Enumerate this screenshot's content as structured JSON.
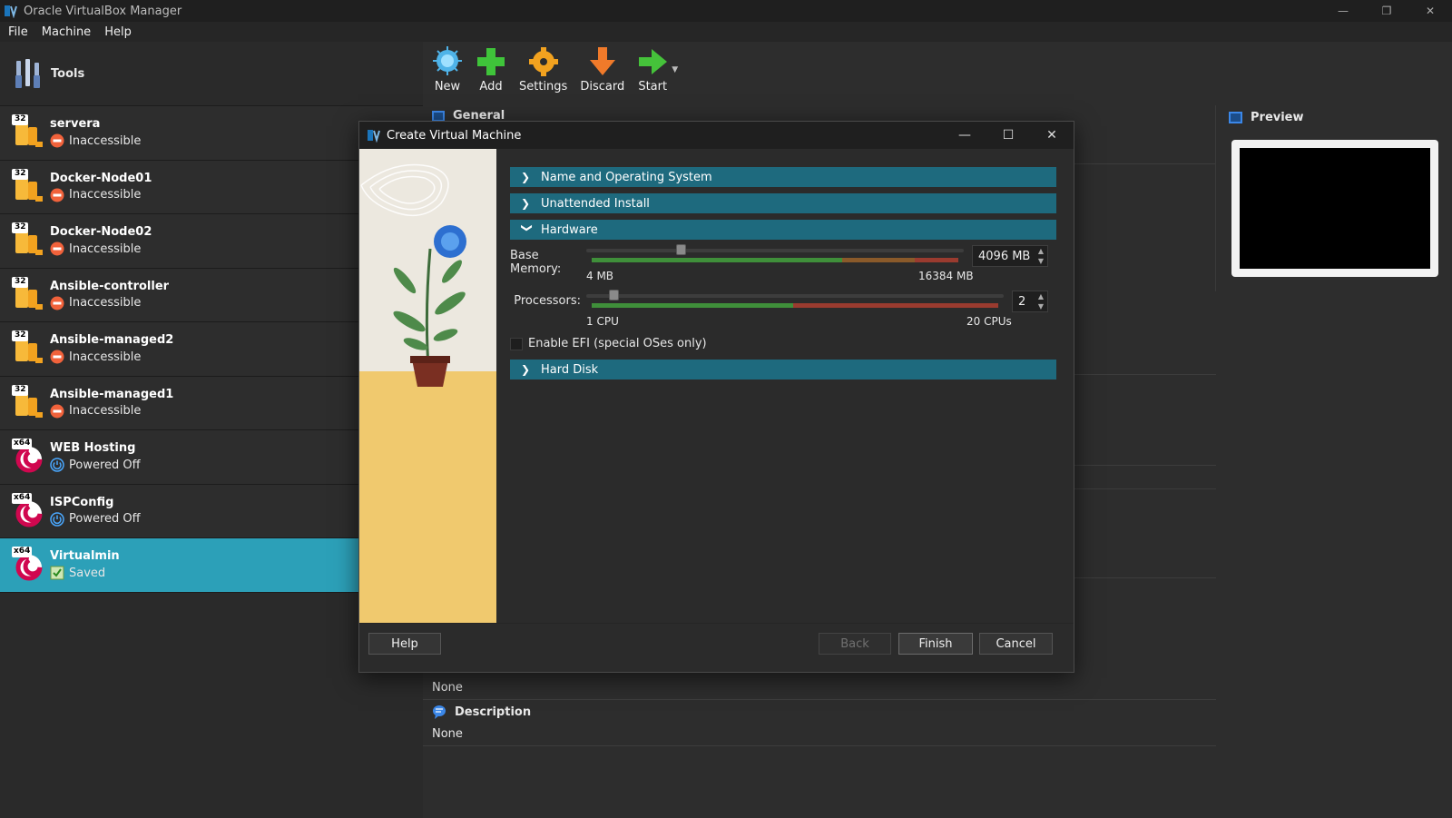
{
  "window": {
    "title": "Oracle VirtualBox Manager",
    "controls": {
      "minimize": "—",
      "restore": "❐",
      "close": "✕"
    }
  },
  "menu": [
    {
      "label": "File"
    },
    {
      "label": "Machine"
    },
    {
      "label": "Help"
    }
  ],
  "tools": {
    "label": "Tools"
  },
  "vms": [
    {
      "name": "servera",
      "status": "Inaccessible",
      "arch": "32",
      "status_type": "inaccessible"
    },
    {
      "name": "Docker-Node01",
      "status": "Inaccessible",
      "arch": "32",
      "status_type": "inaccessible"
    },
    {
      "name": "Docker-Node02",
      "status": "Inaccessible",
      "arch": "32",
      "status_type": "inaccessible"
    },
    {
      "name": "Ansible-controller",
      "status": "Inaccessible",
      "arch": "32",
      "status_type": "inaccessible"
    },
    {
      "name": "Ansible-managed2",
      "status": "Inaccessible",
      "arch": "32",
      "status_type": "inaccessible"
    },
    {
      "name": "Ansible-managed1",
      "status": "Inaccessible",
      "arch": "32",
      "status_type": "inaccessible"
    },
    {
      "name": "WEB Hosting",
      "status": "Powered Off",
      "arch": "x64",
      "status_type": "powered-off"
    },
    {
      "name": "ISPConfig",
      "status": "Powered Off",
      "arch": "x64",
      "status_type": "powered-off"
    },
    {
      "name": "Virtualmin",
      "status": "Saved",
      "arch": "x64",
      "status_type": "saved",
      "selected": true
    }
  ],
  "toolbar": {
    "new": "New",
    "add": "Add",
    "settings": "Settings",
    "discard": "Discard",
    "start": "Start"
  },
  "details": {
    "general": "General",
    "none_1": "None",
    "description": "Description",
    "none_2": "None"
  },
  "preview": {
    "title": "Preview"
  },
  "dialog": {
    "title": "Create Virtual Machine",
    "sections": {
      "name_os": "Name and Operating System",
      "unattended": "Unattended Install",
      "hardware": "Hardware",
      "hard_disk": "Hard Disk"
    },
    "memory": {
      "label": "Base Memory:",
      "value": "4096 MB",
      "min_label": "4 MB",
      "max_label": "16384 MB",
      "fraction": 0.25
    },
    "processors": {
      "label": "Processors:",
      "value": "2",
      "min_label": "1 CPU",
      "max_label": "20 CPUs",
      "fraction": 0.05
    },
    "efi": {
      "label": "Enable EFI (special OSes only)",
      "checked": false
    },
    "buttons": {
      "help": "Help",
      "back": "Back",
      "finish": "Finish",
      "cancel": "Cancel"
    }
  },
  "colors": {
    "accent": "#2ca0b8",
    "section_header": "#1e6a7e",
    "green_range": "#3f8f3a",
    "red_range": "#9a3b2f"
  }
}
